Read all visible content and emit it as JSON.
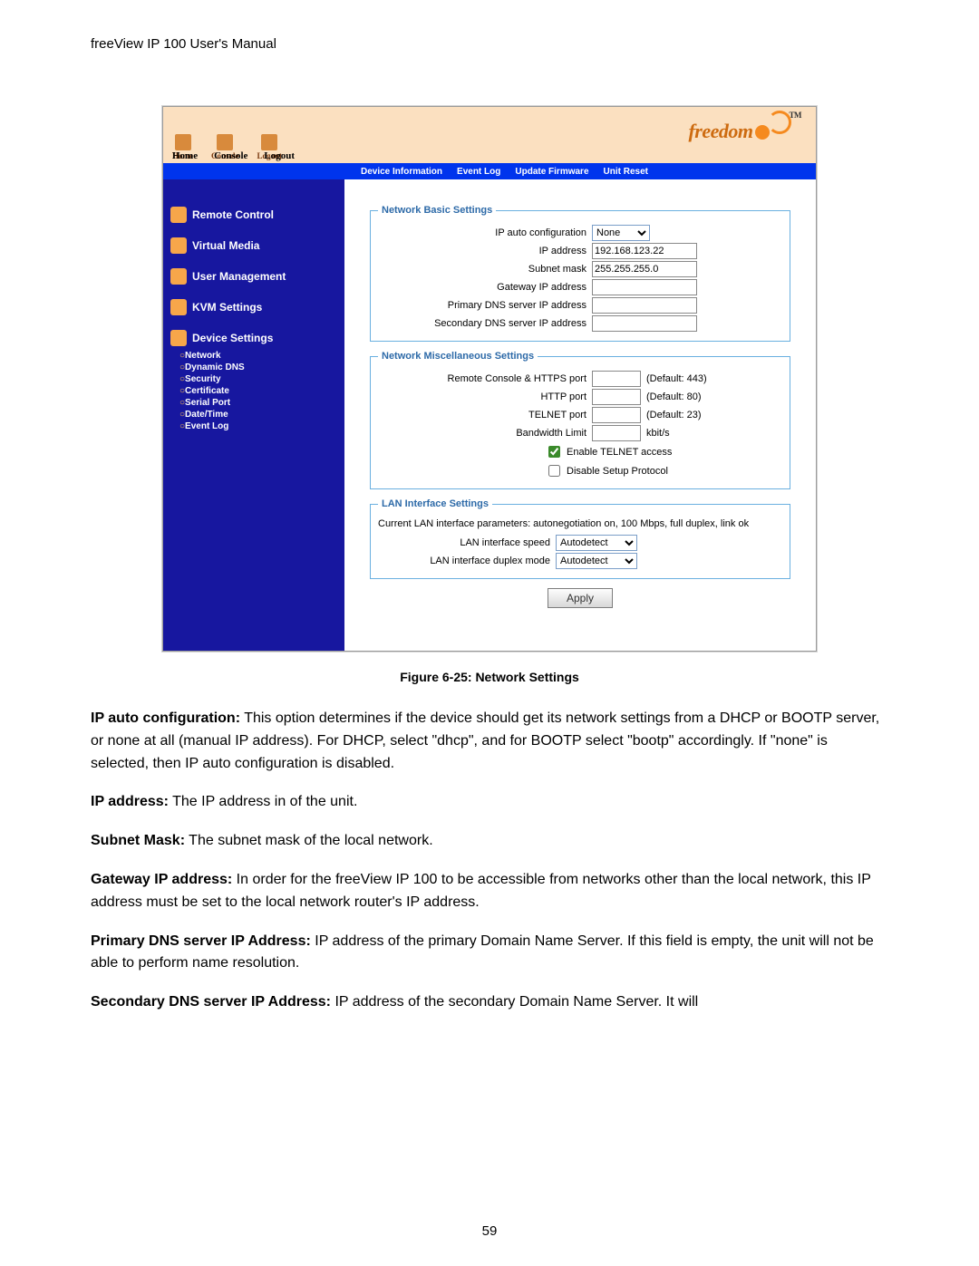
{
  "doc_header": "freeView IP 100 User's Manual",
  "brand": "freedom",
  "toolbar_top": {
    "home": "Home",
    "console": "Console",
    "logout": "Logout"
  },
  "submenu": {
    "device_information": "Device Information",
    "event_log": "Event Log",
    "update_firmware": "Update Firmware",
    "unit_reset": "Unit Reset"
  },
  "nav": {
    "remote_control": "Remote Control",
    "virtual_media": "Virtual Media",
    "user_management": "User Management",
    "kvm_settings": "KVM Settings",
    "device_settings": "Device Settings",
    "sub": {
      "network": "Network",
      "dynamic_dns": "Dynamic DNS",
      "security": "Security",
      "certificate": "Certificate",
      "serial_port": "Serial Port",
      "date_time": "Date/Time",
      "event_log": "Event Log"
    }
  },
  "fieldsets": {
    "basic": {
      "legend": "Network Basic Settings",
      "ip_auto_label": "IP auto configuration",
      "ip_auto_value": "None",
      "ip_address_label": "IP address",
      "ip_address_value": "192.168.123.22",
      "subnet_label": "Subnet mask",
      "subnet_value": "255.255.255.0",
      "gateway_label": "Gateway IP address",
      "gateway_value": "",
      "primary_dns_label": "Primary DNS server IP address",
      "primary_dns_value": "",
      "secondary_dns_label": "Secondary DNS server IP address",
      "secondary_dns_value": ""
    },
    "misc": {
      "legend": "Network Miscellaneous Settings",
      "https_label": "Remote Console & HTTPS port",
      "https_value": "",
      "https_hint": "(Default: 443)",
      "http_label": "HTTP port",
      "http_value": "",
      "http_hint": "(Default: 80)",
      "telnet_label": "TELNET port",
      "telnet_value": "",
      "telnet_hint": "(Default: 23)",
      "bw_label": "Bandwidth Limit",
      "bw_value": "",
      "bw_hint": "kbit/s",
      "enable_telnet": "Enable TELNET access",
      "disable_setup": "Disable Setup Protocol"
    },
    "lan": {
      "legend": "LAN Interface Settings",
      "current_text": "Current LAN interface parameters:  autonegotiation on, 100 Mbps, full duplex, link ok",
      "speed_label": "LAN interface speed",
      "speed_value": "Autodetect",
      "duplex_label": "LAN interface duplex mode",
      "duplex_value": "Autodetect"
    }
  },
  "apply": "Apply",
  "figure_caption": "Figure 6-25: Network Settings",
  "paragraphs": {
    "p1_b": "IP auto configuration:",
    "p1": " This option determines if the device should get its network settings from a DHCP or BOOTP server, or none at all (manual IP address). For DHCP, select \"dhcp\", and for BOOTP select \"bootp\" accordingly. If \"none\" is selected, then IP auto configuration is disabled.",
    "p2_b": "IP address:",
    "p2": " The IP address in of the unit.",
    "p3_b": "Subnet Mask:",
    "p3": " The subnet mask of the local network.",
    "p4_b": "Gateway IP address:",
    "p4": " In order for the freeView IP 100 to be accessible from networks other than the local network, this IP address must be set to the local network router's IP address.",
    "p5_b": "Primary DNS server IP Address:",
    "p5": " IP address of the primary Domain Name Server. If this field is empty, the unit will not be able to perform name resolution.",
    "p6_b": "Secondary DNS server IP Address:",
    "p6": "  IP address of the secondary Domain Name Server. It will"
  },
  "page_number": "59"
}
